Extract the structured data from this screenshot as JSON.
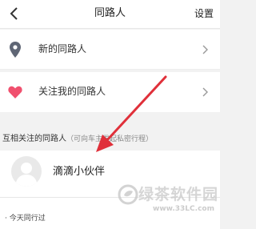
{
  "header": {
    "back_icon": "chevron-left-icon",
    "title": "同路人",
    "settings_label": "设置"
  },
  "menu": [
    {
      "label": "新的同路人",
      "icon": "location-pin-icon",
      "icon_color": "#5f6675"
    },
    {
      "label": "关注我的同路人",
      "icon": "heart-icon",
      "icon_color": "#f0506e"
    }
  ],
  "section": {
    "title": "互相关注的同路人",
    "subtitle": "（可向车主发起私密行程）"
  },
  "contact": {
    "name": "滴滴小伙伴"
  },
  "trip": {
    "text": "· 今天同行过"
  },
  "annotation": {
    "arrow_color": "#e0303a"
  },
  "watermark": {
    "logo_text": "绿茶软件园",
    "url": "www.33LC.com"
  }
}
